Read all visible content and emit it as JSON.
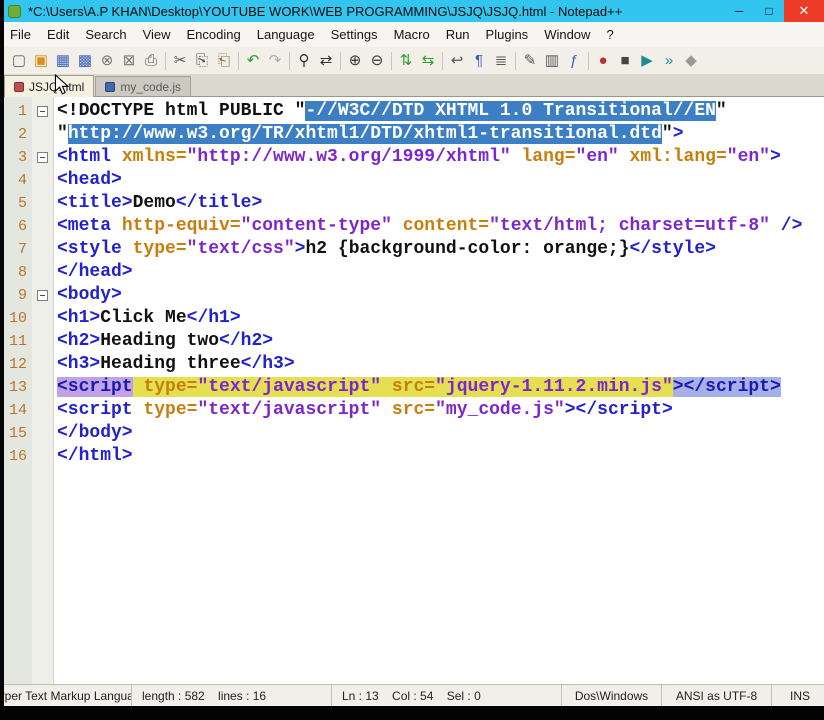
{
  "window": {
    "title": "*C:\\Users\\A.P KHAN\\Desktop\\YOUTUBE WORK\\WEB PROGRAMMING\\JSJQ\\JSJQ.html - Notepad++",
    "buttons": {
      "minimize": "─",
      "maximize": "□",
      "close": "✕"
    }
  },
  "menu": {
    "items": [
      "File",
      "Edit",
      "Search",
      "View",
      "Encoding",
      "Language",
      "Settings",
      "Macro",
      "Run",
      "Plugins",
      "Window",
      "?"
    ]
  },
  "toolbar": {
    "icons": [
      {
        "name": "new-file-icon",
        "glyph": "▢",
        "color": "#666666"
      },
      {
        "name": "open-file-icon",
        "glyph": "▣",
        "color": "#d98e1f"
      },
      {
        "name": "save-icon",
        "glyph": "▦",
        "color": "#3b5fc0"
      },
      {
        "name": "save-all-icon",
        "glyph": "▩",
        "color": "#3b5fc0"
      },
      {
        "name": "close-file-icon",
        "glyph": "⊗",
        "color": "#777777"
      },
      {
        "name": "close-all-icon",
        "glyph": "⊠",
        "color": "#777777"
      },
      {
        "name": "print-icon",
        "glyph": "⎙",
        "color": "#555555"
      },
      {
        "sep": true
      },
      {
        "name": "cut-icon",
        "glyph": "✂",
        "color": "#555555"
      },
      {
        "name": "copy-icon",
        "glyph": "⎘",
        "color": "#555555"
      },
      {
        "name": "paste-icon",
        "glyph": "⎗",
        "color": "#8a6d3b"
      },
      {
        "sep": true
      },
      {
        "name": "undo-icon",
        "glyph": "↶",
        "color": "#2fa02f"
      },
      {
        "name": "redo-icon",
        "glyph": "↷",
        "color": "#aaaaaa"
      },
      {
        "sep": true
      },
      {
        "name": "find-icon",
        "glyph": "⚲",
        "color": "#333333"
      },
      {
        "name": "replace-icon",
        "glyph": "⇄",
        "color": "#333333"
      },
      {
        "sep": true
      },
      {
        "name": "zoom-in-icon",
        "glyph": "⊕",
        "color": "#333333"
      },
      {
        "name": "zoom-out-icon",
        "glyph": "⊖",
        "color": "#333333"
      },
      {
        "sep": true
      },
      {
        "name": "sync-vertical-icon",
        "glyph": "⇅",
        "color": "#2fa02f"
      },
      {
        "name": "sync-horizontal-icon",
        "glyph": "⇆",
        "color": "#2fa02f"
      },
      {
        "sep": true
      },
      {
        "name": "word-wrap-icon",
        "glyph": "↩",
        "color": "#555555"
      },
      {
        "name": "show-all-characters-icon",
        "glyph": "¶",
        "color": "#3b5fc0"
      },
      {
        "name": "indent-guide-icon",
        "glyph": "≣",
        "color": "#555555"
      },
      {
        "sep": true
      },
      {
        "name": "user-language-icon",
        "glyph": "✎",
        "color": "#555555"
      },
      {
        "name": "document-map-icon",
        "glyph": "▥",
        "color": "#555555"
      },
      {
        "name": "function-list-icon",
        "glyph": "ƒ",
        "color": "#3b5fc0"
      },
      {
        "sep": true
      },
      {
        "name": "record-macro-icon",
        "glyph": "●",
        "color": "#c03030"
      },
      {
        "name": "stop-record-icon",
        "glyph": "■",
        "color": "#444444"
      },
      {
        "name": "playback-macro-icon",
        "glyph": "▶",
        "color": "#1b8c8c"
      },
      {
        "name": "run-macro-multiple-icon",
        "glyph": "»",
        "color": "#1b8c8c"
      },
      {
        "name": "save-macro-icon",
        "glyph": "◆",
        "color": "#999999"
      }
    ]
  },
  "tabs": [
    {
      "label": "JSJQ.html",
      "active": true,
      "modified": true,
      "icon_color": "#c0504d"
    },
    {
      "label": "my_code.js",
      "active": false,
      "modified": false,
      "icon_color": "#4169b0"
    }
  ],
  "editor": {
    "lines": [
      {
        "num": 1,
        "fold": true,
        "tokens": [
          {
            "t": "<!DOCTYPE html PUBLIC \"",
            "c": "plain"
          },
          {
            "t": "-//W3C//DTD XHTML 1.0 Transitional//EN",
            "c": "dhl"
          },
          {
            "t": "\"",
            "c": "plain"
          }
        ]
      },
      {
        "num": 2,
        "tokens": [
          {
            "t": "\"",
            "c": "plain"
          },
          {
            "t": "http://www.w3.org/TR/xhtml1/DTD/xhtml1-transitional.dtd",
            "c": "dhl"
          },
          {
            "t": "\"",
            "c": "plain"
          },
          {
            "t": ">",
            "c": "tag"
          }
        ]
      },
      {
        "num": 3,
        "fold": true,
        "tokens": [
          {
            "t": "<html ",
            "c": "tag"
          },
          {
            "t": "xmlns=",
            "c": "attr"
          },
          {
            "t": "\"http://www.w3.org/1999/xhtml\"",
            "c": "val"
          },
          {
            "t": " ",
            "c": "plain"
          },
          {
            "t": "lang=",
            "c": "attr"
          },
          {
            "t": "\"en\"",
            "c": "val"
          },
          {
            "t": " ",
            "c": "plain"
          },
          {
            "t": "xml:lang=",
            "c": "attr"
          },
          {
            "t": "\"en\"",
            "c": "val"
          },
          {
            "t": ">",
            "c": "tag"
          }
        ]
      },
      {
        "num": 4,
        "tokens": [
          {
            "t": "<head>",
            "c": "tag"
          }
        ]
      },
      {
        "num": 5,
        "tokens": [
          {
            "t": "<title>",
            "c": "tag"
          },
          {
            "t": "Demo",
            "c": "plain"
          },
          {
            "t": "</title>",
            "c": "tag"
          }
        ]
      },
      {
        "num": 6,
        "tokens": [
          {
            "t": "<meta ",
            "c": "tag"
          },
          {
            "t": "http-equiv=",
            "c": "attr"
          },
          {
            "t": "\"content-type\"",
            "c": "val"
          },
          {
            "t": " ",
            "c": "plain"
          },
          {
            "t": "content=",
            "c": "attr"
          },
          {
            "t": "\"text/html; charset=utf-8\"",
            "c": "val"
          },
          {
            "t": " ",
            "c": "plain"
          },
          {
            "t": "/>",
            "c": "tag"
          }
        ]
      },
      {
        "num": 7,
        "tokens": [
          {
            "t": "<style ",
            "c": "tag"
          },
          {
            "t": "type=",
            "c": "attr"
          },
          {
            "t": "\"text/css\"",
            "c": "val"
          },
          {
            "t": ">",
            "c": "tag"
          },
          {
            "t": "h2 {background-color: orange;}",
            "c": "plain"
          },
          {
            "t": "</style>",
            "c": "tag"
          }
        ]
      },
      {
        "num": 8,
        "tokens": [
          {
            "t": "</head>",
            "c": "tag"
          }
        ]
      },
      {
        "num": 9,
        "fold": true,
        "tokens": [
          {
            "t": "<body>",
            "c": "tag"
          }
        ]
      },
      {
        "num": 10,
        "tokens": [
          {
            "t": "<h1>",
            "c": "tag"
          },
          {
            "t": "Click Me",
            "c": "plain"
          },
          {
            "t": "</h1>",
            "c": "tag"
          }
        ]
      },
      {
        "num": 11,
        "tokens": [
          {
            "t": "<h2>",
            "c": "tag"
          },
          {
            "t": "Heading two",
            "c": "plain"
          },
          {
            "t": "</h2>",
            "c": "tag"
          }
        ]
      },
      {
        "num": 12,
        "tokens": [
          {
            "t": "<h3>",
            "c": "tag"
          },
          {
            "t": "Heading three",
            "c": "plain"
          },
          {
            "t": "</h3>",
            "c": "tag"
          }
        ]
      },
      {
        "num": 13,
        "tokens": [
          {
            "t": "<script",
            "c": "tag hlTag"
          },
          {
            "t": " ",
            "c": "plain hlMid"
          },
          {
            "t": "type=",
            "c": "attr hlMid"
          },
          {
            "t": "\"text/javascript\"",
            "c": "val hlMid"
          },
          {
            "t": " ",
            "c": "plain hlMid"
          },
          {
            "t": "src=",
            "c": "attr hlMid"
          },
          {
            "t": "\"jquery-1.11.2.min.js\"",
            "c": "val hlMid"
          },
          {
            "t": "></script>",
            "c": "tag hlClose"
          }
        ]
      },
      {
        "num": 14,
        "tokens": [
          {
            "t": "<script ",
            "c": "tag"
          },
          {
            "t": "type=",
            "c": "attr"
          },
          {
            "t": "\"text/javascript\"",
            "c": "val"
          },
          {
            "t": " ",
            "c": "plain"
          },
          {
            "t": "src=",
            "c": "attr"
          },
          {
            "t": "\"my_code.js\"",
            "c": "val"
          },
          {
            "t": "></script>",
            "c": "tag"
          }
        ]
      },
      {
        "num": 15,
        "tokens": [
          {
            "t": "</body>",
            "c": "tag"
          }
        ]
      },
      {
        "num": 16,
        "tokens": [
          {
            "t": "</html>",
            "c": "tag"
          }
        ]
      }
    ]
  },
  "statusbar": {
    "file_type": "Hyper Text Markup Language file",
    "length_info": "length : 582    lines : 16",
    "cursor_info": "Ln : 13    Col : 54    Sel : 0",
    "eol_format": "Dos\\Windows",
    "encoding": "ANSI as UTF-8",
    "typing_mode": "INS"
  }
}
